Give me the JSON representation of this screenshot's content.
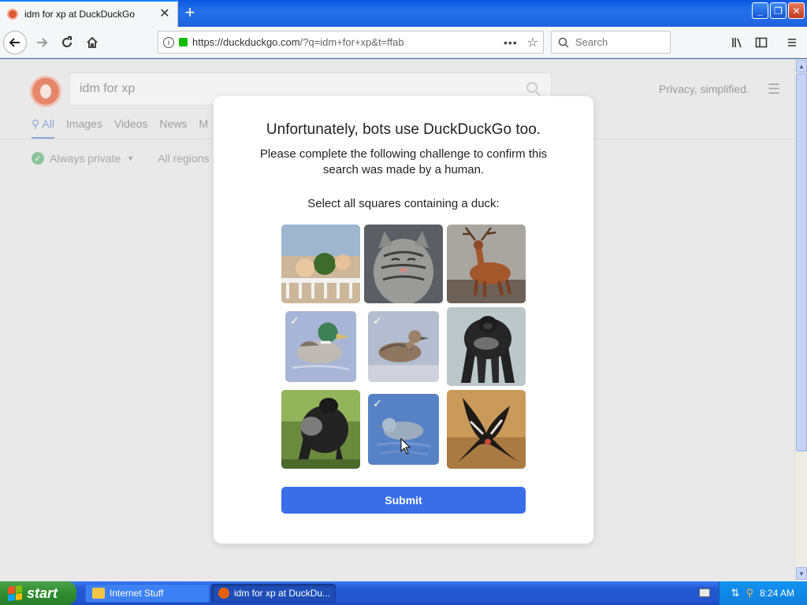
{
  "browser": {
    "tab_title": "idm for xp at DuckDuckGo",
    "url_host": "https://duckduckgo.com",
    "url_path": "/?q=idm+for+xp&t=ffab",
    "search_placeholder": "Search"
  },
  "page": {
    "query": "idm for xp",
    "privacy_text": "Privacy, simplified.",
    "tabs": [
      "All",
      "Images",
      "Videos",
      "News",
      "M"
    ],
    "filter_private": "Always private",
    "filter_region": "All regions"
  },
  "captcha": {
    "title": "Unfortunately, bots use DuckDuckGo too.",
    "subtitle": "Please complete the following challenge to confirm this search was made by a human.",
    "instruction": "Select all squares containing a duck:",
    "submit_label": "Submit",
    "tiles": [
      {
        "subject": "dogs on railing",
        "selected": false
      },
      {
        "subject": "tabby cat",
        "selected": false
      },
      {
        "subject": "deer stag",
        "selected": false
      },
      {
        "subject": "mallard duck",
        "selected": true
      },
      {
        "subject": "brown duck",
        "selected": true
      },
      {
        "subject": "gorilla",
        "selected": false
      },
      {
        "subject": "gorilla",
        "selected": false
      },
      {
        "subject": "swimming duck",
        "selected": true
      },
      {
        "subject": "condor",
        "selected": false
      }
    ]
  },
  "taskbar": {
    "start_label": "start",
    "task1": "Internet Stuff",
    "task2": "idm for xp at DuckDu...",
    "clock": "8:24 AM"
  }
}
